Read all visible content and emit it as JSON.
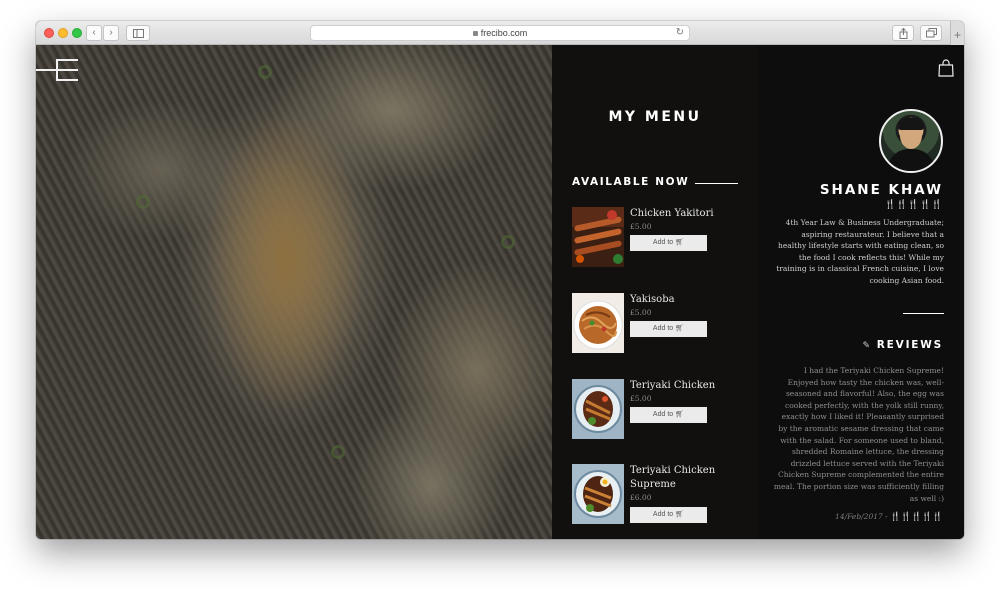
{
  "browser": {
    "url": "frecibo.com",
    "reload_glyph": "↻",
    "back_glyph": "‹",
    "forward_glyph": "›",
    "new_tab_glyph": "+"
  },
  "menu": {
    "title": "MY MENU",
    "available_label": "AVAILABLE NOW",
    "items": [
      {
        "name": "Chicken Yakitori",
        "price": "£5.00",
        "add_label": "Add to",
        "thumb_icon": "yakitori-photo"
      },
      {
        "name": "Yakisoba",
        "price": "£5.00",
        "add_label": "Add to",
        "thumb_icon": "yakisoba-photo"
      },
      {
        "name": "Teriyaki Chicken",
        "price": "£5.00",
        "add_label": "Add to",
        "thumb_icon": "teriyaki-photo"
      },
      {
        "name": "Teriyaki Chicken Supreme",
        "price": "£6.00",
        "add_label": "Add to",
        "thumb_icon": "teriyaki-supreme-photo"
      }
    ]
  },
  "profile": {
    "name": "SHANE KHAW",
    "rating_glyphs": "🍴🍴🍴🍴🍴",
    "bio": "4th Year Law & Business Undergraduate; aspiring restaurateur. I believe that a healthy lifestyle starts with eating clean, so the food I cook reflects this! While my training is in classical French cuisine, I love cooking Asian food.",
    "reviews_label": "REVIEWS",
    "review_text": "I had the Teriyaki Chicken Supreme! Enjoyed how tasty the chicken was, well-seasoned and flavorful! Also, the egg was cooked perfectly, with the yolk still runny, exactly how I liked it! Pleasantly surprised by the aromatic sesame dressing that came with the salad. For someone used to bland, shredded Romaine lettuce, the dressing drizzled lettuce served with the Teriyaki Chicken Supreme complemented the entire meal. The portion size was sufficiently filling as well :)",
    "review_date": "14/Feb/2017 -",
    "review_rating_glyphs": "🍴🍴🍴🍴🍴"
  },
  "colors": {
    "menu_panel_bg": "#12110f",
    "profile_panel_bg": "#0d0d0d",
    "button_bg": "#ebebeb",
    "rating_green": "#6b7f6b"
  }
}
